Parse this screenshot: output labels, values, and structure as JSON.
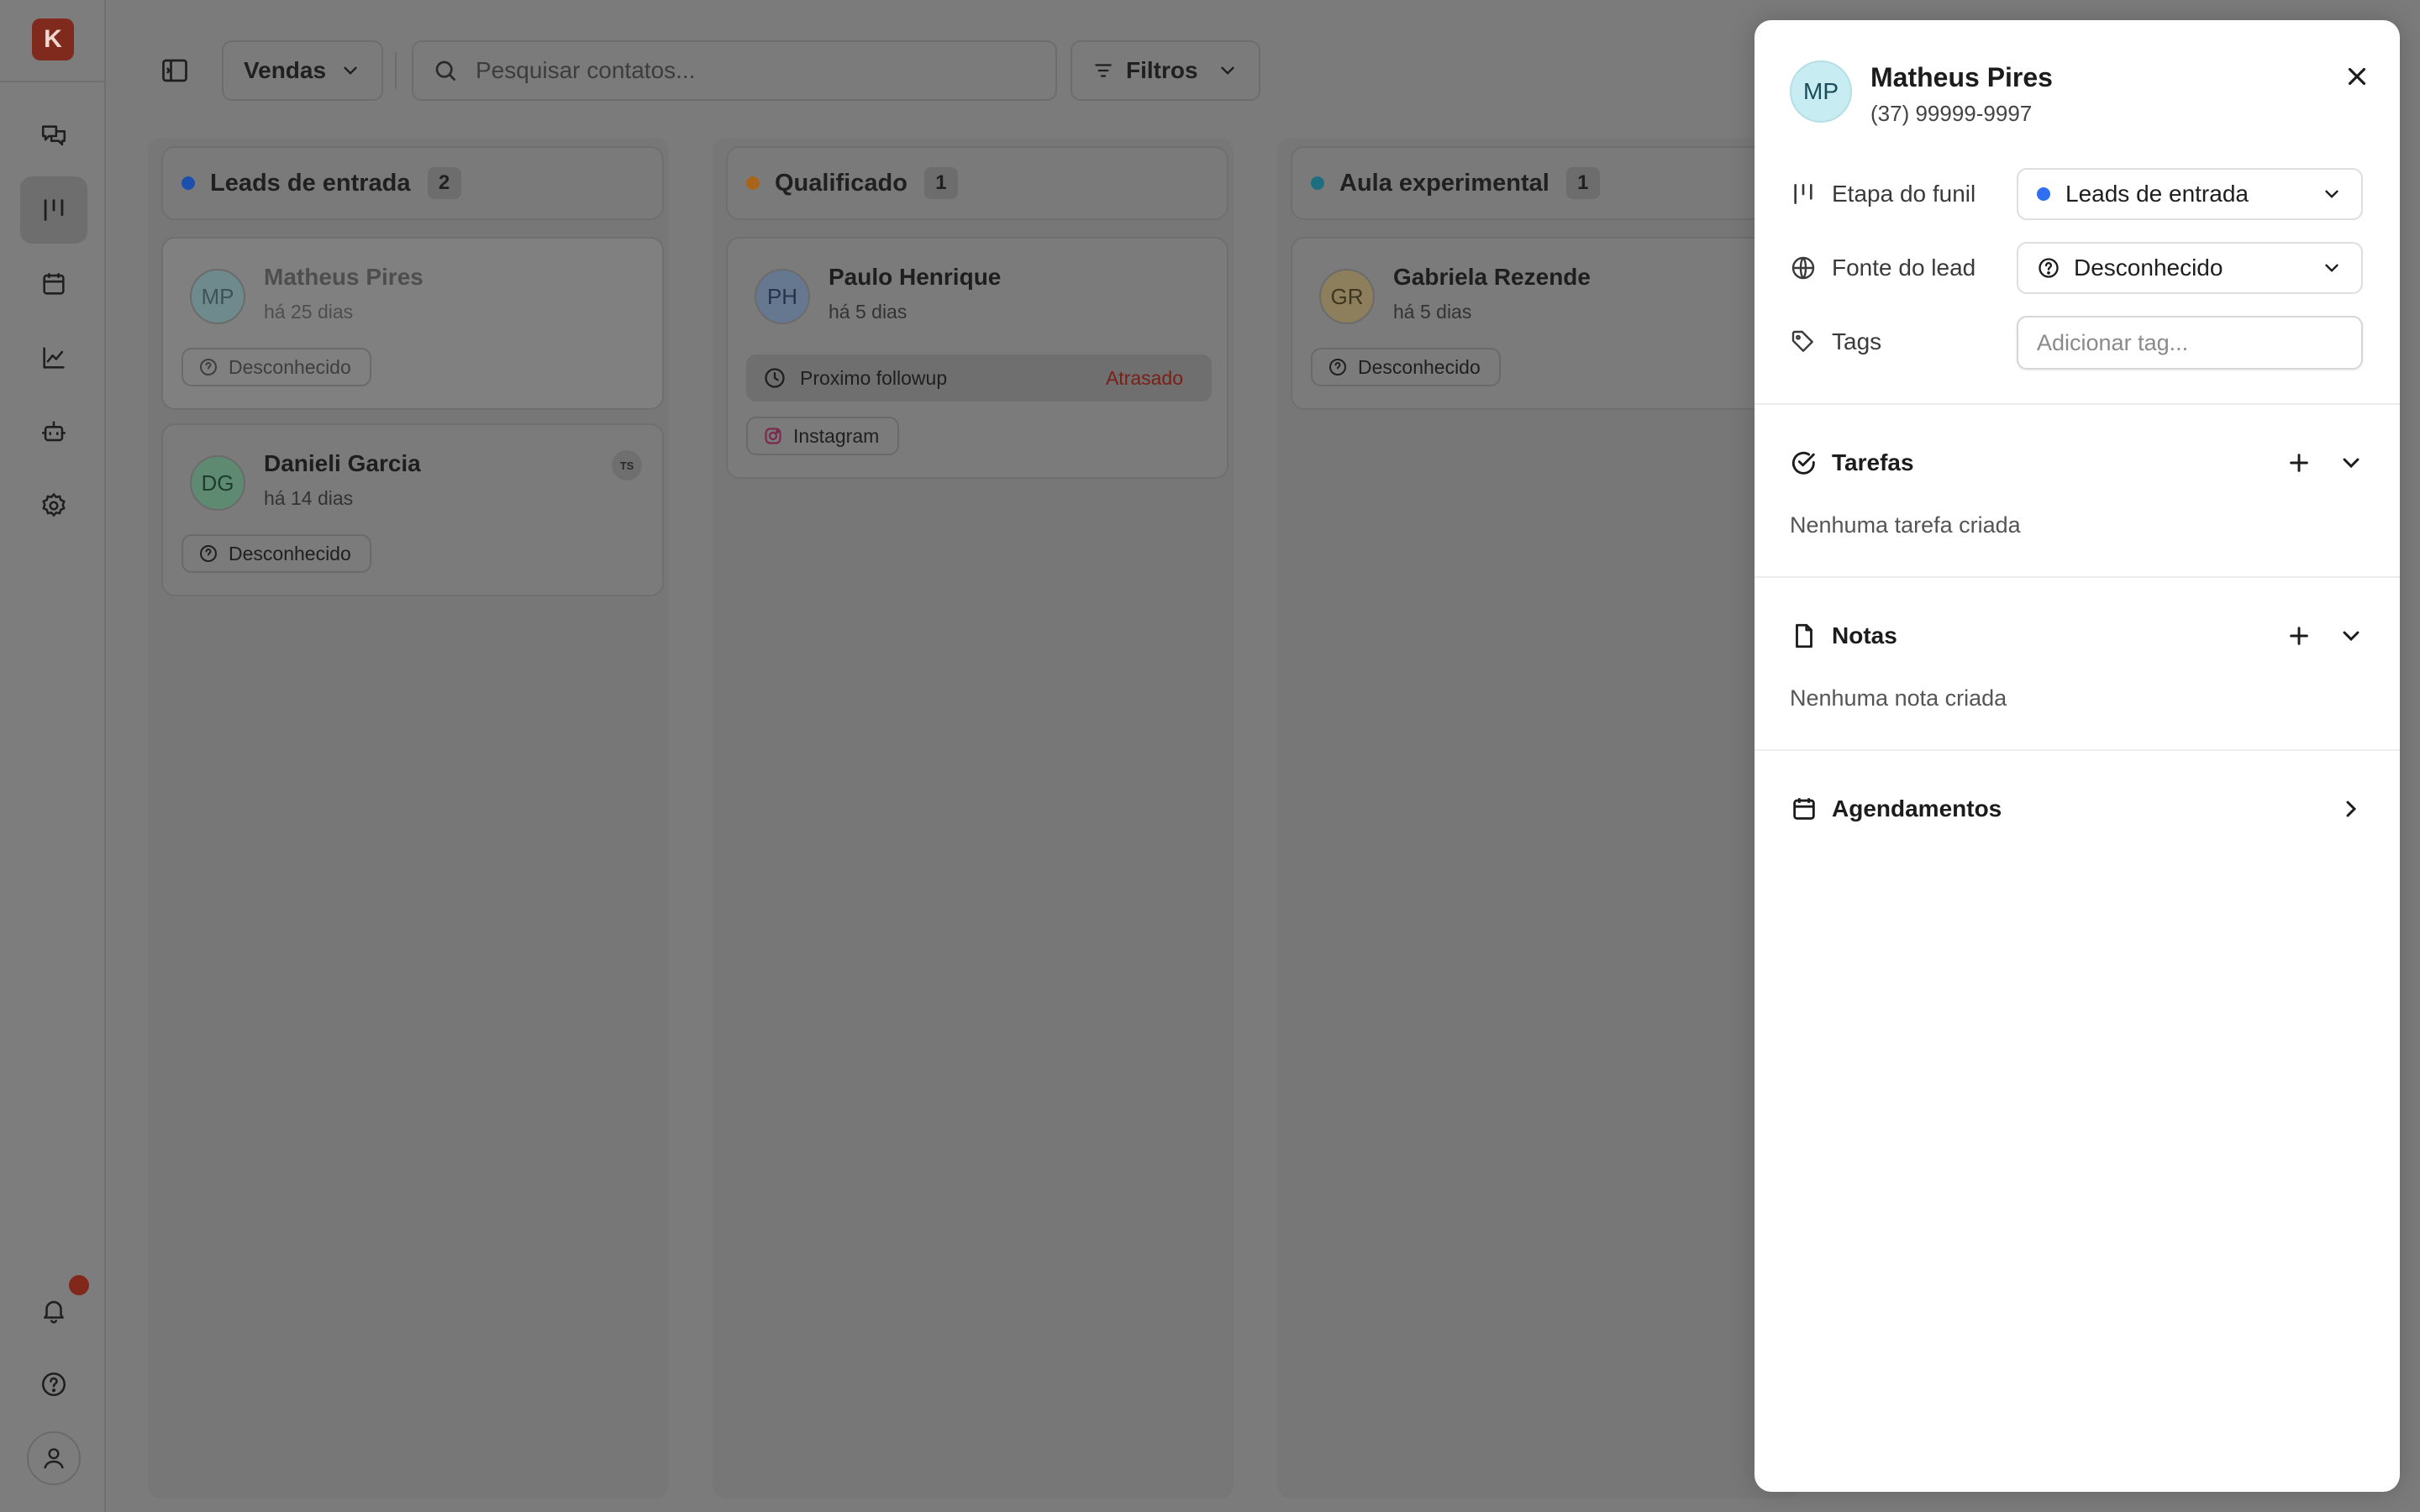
{
  "sidebar": {
    "logo_letter": "K",
    "nav": [
      {
        "name": "conversations",
        "icon": "chat-icon",
        "active": false
      },
      {
        "name": "pipeline",
        "icon": "kanban-icon",
        "active": true
      },
      {
        "name": "calendar",
        "icon": "calendar-icon",
        "active": false
      },
      {
        "name": "reports",
        "icon": "chart-line-icon",
        "active": false
      },
      {
        "name": "automations",
        "icon": "bot-icon",
        "active": false
      },
      {
        "name": "settings",
        "icon": "gear-icon",
        "active": false
      }
    ],
    "bottom": [
      "bell-icon",
      "help-icon",
      "user-icon"
    ]
  },
  "toolbar": {
    "pipeline_select": "Vendas",
    "search_placeholder": "Pesquisar contatos...",
    "filters_label": "Filtros"
  },
  "columns": [
    {
      "title": "Leads de entrada",
      "count": "2",
      "dot_color": "#1d4fae",
      "cards": [
        {
          "initials": "MP",
          "name": "Matheus Pires",
          "ago": "há 25 dias",
          "source": "Desconhecido",
          "avatar_bg": "#6f8a8c",
          "faded": true
        },
        {
          "initials": "DG",
          "name": "Danieli Garcia",
          "ago": "há 14 dias",
          "source": "Desconhecido",
          "avatar_bg": "#5f8a72",
          "badge": "TS"
        }
      ]
    },
    {
      "title": "Qualificado",
      "count": "1",
      "dot_color": "#a8641a",
      "cards": [
        {
          "initials": "PH",
          "name": "Paulo Henrique",
          "ago": "há 5 dias",
          "avatar_bg": "#66788f",
          "followup_label": "Proximo followup",
          "followup_status": "Atrasado",
          "source": "Instagram"
        }
      ]
    },
    {
      "title": "Aula experimental",
      "count": "1",
      "dot_color": "#1d6f80",
      "cards": [
        {
          "initials": "GR",
          "name": "Gabriela Rezende",
          "ago": "há 5 dias",
          "source": "Desconhecido",
          "avatar_bg": "#8d7f5c"
        }
      ]
    }
  ],
  "panel": {
    "initials": "MP",
    "name": "Matheus Pires",
    "phone": "(37) 99999-9997",
    "fields": {
      "stage_label": "Etapa do funil",
      "stage_value": "Leads de entrada",
      "source_label": "Fonte do lead",
      "source_value": "Desconhecido",
      "tags_label": "Tags",
      "tags_placeholder": "Adicionar tag..."
    },
    "tasks": {
      "title": "Tarefas",
      "empty": "Nenhuma tarefa criada"
    },
    "notes": {
      "title": "Notas",
      "empty": "Nenhuma nota criada"
    },
    "appointments": {
      "title": "Agendamentos"
    }
  }
}
